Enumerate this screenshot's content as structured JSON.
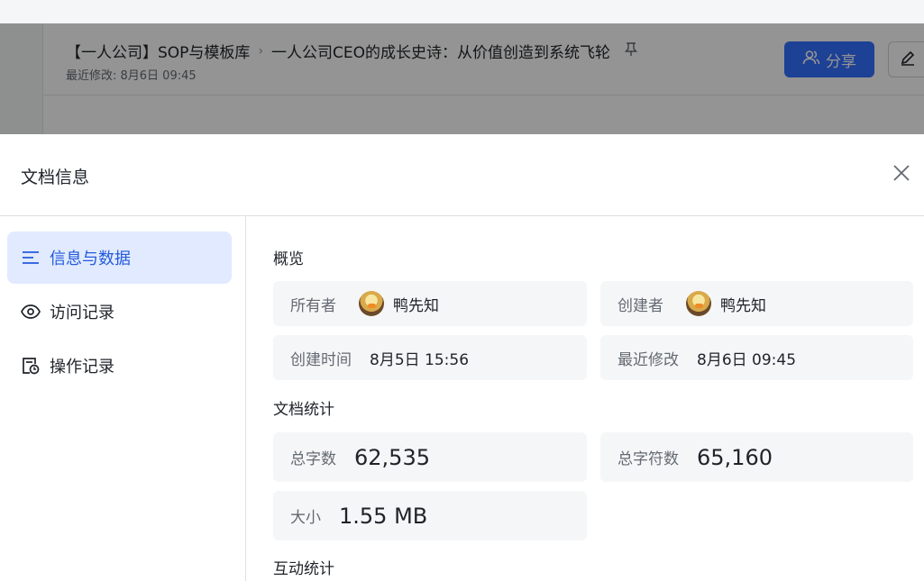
{
  "background_page": {
    "breadcrumb_parent": "【一人公司】SOP与模板库",
    "breadcrumb_separator": "›",
    "doc_title": "一人公司CEO的成长史诗：从价值创造到系统飞轮",
    "last_modified": "最近修改: 8月6日 09:45",
    "share_label": "分享",
    "share_icon": "people-icon",
    "edit_icon": "edit-pencil-icon",
    "pin_icon": "pin-icon"
  },
  "dialog": {
    "title": "文档信息",
    "close_icon": "close-icon"
  },
  "nav": [
    {
      "label": "信息与数据",
      "icon": "list-icon",
      "active": true
    },
    {
      "label": "访问记录",
      "icon": "eye-icon",
      "active": false
    },
    {
      "label": "操作记录",
      "icon": "history-icon",
      "active": false
    }
  ],
  "overview": {
    "title": "概览",
    "owner_label": "所有者",
    "owner_name": "鸭先知",
    "creator_label": "创建者",
    "creator_name": "鸭先知",
    "created_label": "创建时间",
    "created_value": "8月5日 15:56",
    "modified_label": "最近修改",
    "modified_value": "8月6日 09:45"
  },
  "stats": {
    "title": "文档统计",
    "words_label": "总字数",
    "words_value": "62,535",
    "chars_label": "总字符数",
    "chars_value": "65,160",
    "size_label": "大小",
    "size_value": "1.55 MB"
  },
  "interaction": {
    "title": "互动统计"
  },
  "colors": {
    "accent": "#3370ff",
    "active_nav_bg": "#e1eaff",
    "active_nav_text": "#245bdb",
    "card_bg": "#f5f6f7"
  }
}
